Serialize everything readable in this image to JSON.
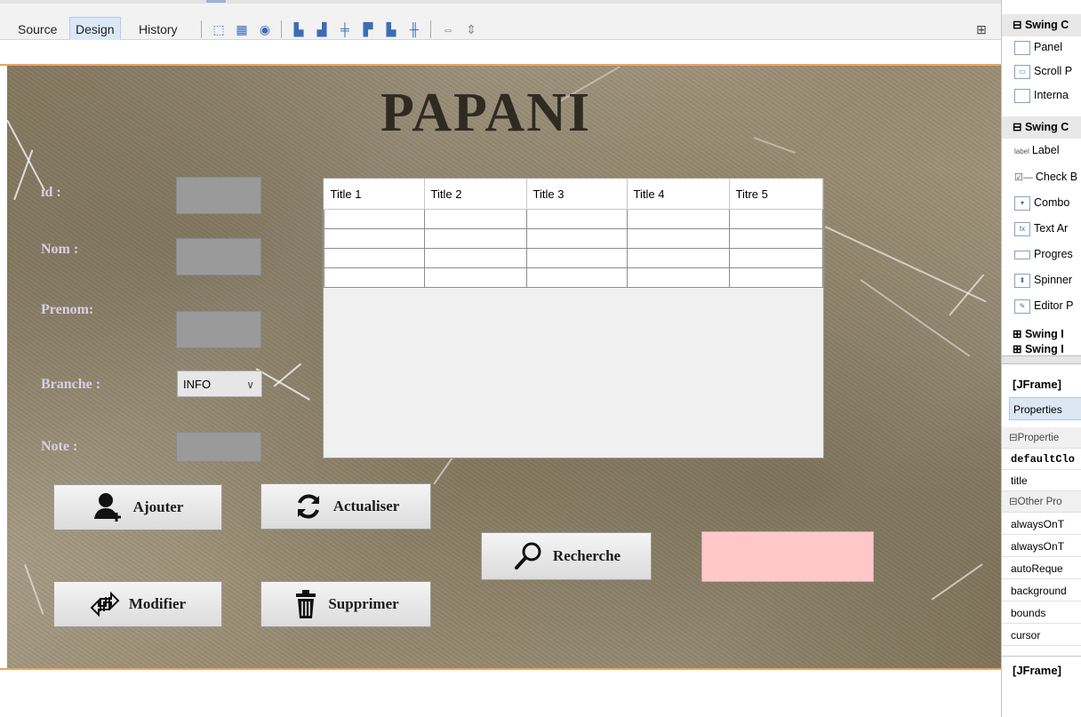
{
  "toolbar": {
    "tabs": [
      "Source",
      "Design",
      "History"
    ],
    "active_tab": "Design"
  },
  "form": {
    "title": "PAPANI",
    "labels": {
      "id": "id :",
      "nom": "Nom :",
      "prenom": "Prenom:",
      "branche": "Branche :",
      "note": "Note :"
    },
    "branche_value": "INFO",
    "table": {
      "headers": [
        "Title 1",
        "Title 2",
        "Title 3",
        "Title 4",
        "Titre 5"
      ],
      "rows": [
        [
          "",
          "",
          "",
          "",
          ""
        ],
        [
          "",
          "",
          "",
          "",
          ""
        ],
        [
          "",
          "",
          "",
          "",
          ""
        ],
        [
          "",
          "",
          "",
          "",
          ""
        ]
      ]
    },
    "buttons": {
      "ajouter": "Ajouter",
      "actualiser": "Actualiser",
      "recherche": "Recherche",
      "modifier": "Modifier",
      "supprimer": "Supprimer"
    },
    "colors": {
      "search_field": "#ffc8c8",
      "input_field": "#9a9a9a"
    }
  },
  "palette": {
    "items": [
      {
        "type": "category",
        "label": "Swing C"
      },
      {
        "type": "item",
        "label": "Panel",
        "icon": "panel-icon"
      },
      {
        "type": "item",
        "label": "Scroll P",
        "icon": "scroll-pane-icon"
      },
      {
        "type": "item",
        "label": "Interna",
        "icon": "internal-frame-icon"
      },
      {
        "type": "category",
        "label": "Swing C"
      },
      {
        "type": "item",
        "label": "Label",
        "icon": "label-icon"
      },
      {
        "type": "item",
        "label": "Check B",
        "icon": "checkbox-icon"
      },
      {
        "type": "item",
        "label": "Combo",
        "icon": "combobox-icon"
      },
      {
        "type": "item",
        "label": "Text Ar",
        "icon": "textarea-icon"
      },
      {
        "type": "item",
        "label": "Progres",
        "icon": "progressbar-icon"
      },
      {
        "type": "item",
        "label": "Spinner",
        "icon": "spinner-icon"
      },
      {
        "type": "item",
        "label": "Editor P",
        "icon": "editor-pane-icon"
      },
      {
        "type": "category",
        "label": "Swing I"
      },
      {
        "type": "category",
        "label": "Swing I"
      }
    ],
    "frame_header": "[JFrame]",
    "properties_tab": "Properties",
    "props": [
      {
        "type": "section",
        "label": "Propertie"
      },
      {
        "type": "bold",
        "label": "defaultClo"
      },
      {
        "type": "plain",
        "label": "title"
      },
      {
        "type": "section",
        "label": "Other Pro"
      },
      {
        "type": "plain",
        "label": "alwaysOnT"
      },
      {
        "type": "plain",
        "label": "alwaysOnT"
      },
      {
        "type": "plain",
        "label": "autoReque"
      },
      {
        "type": "plain",
        "label": "background"
      },
      {
        "type": "plain",
        "label": "bounds"
      },
      {
        "type": "plain",
        "label": "cursor"
      }
    ],
    "frame_footer": "[JFrame]"
  }
}
